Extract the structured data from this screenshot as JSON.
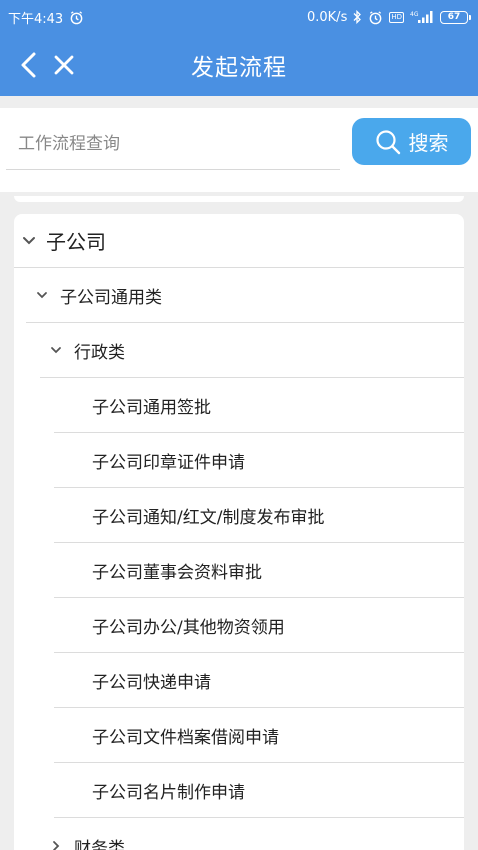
{
  "status_bar": {
    "time": "下午4:43",
    "network_speed": "0.0K/s",
    "network_type": "4G",
    "battery": "67"
  },
  "nav": {
    "title": "发起流程"
  },
  "search": {
    "placeholder": "工作流程查询",
    "value": "",
    "button_label": "搜索"
  },
  "tree": {
    "root": {
      "label": "子公司",
      "expanded": true
    },
    "category": {
      "label": "子公司通用类",
      "expanded": true
    },
    "groups": [
      {
        "label": "行政类",
        "expanded": true,
        "items": [
          "子公司通用签批",
          "子公司印章证件申请",
          "子公司通知/红文/制度发布审批",
          "子公司董事会资料审批",
          "子公司办公/其他物资领用",
          "子公司快递申请",
          "子公司文件档案借阅申请",
          "子公司名片制作申请"
        ]
      },
      {
        "label": "财务类",
        "expanded": false
      }
    ]
  },
  "colors": {
    "header": "#4a90e2",
    "search_button": "#4aa8ec",
    "background": "#eeeeee"
  }
}
